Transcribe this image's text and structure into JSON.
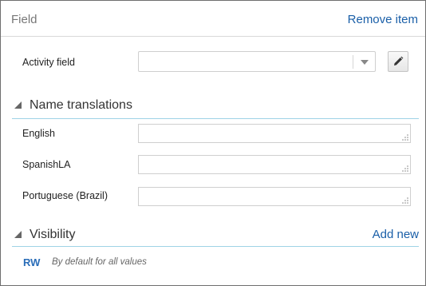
{
  "header": {
    "title": "Field",
    "remove_label": "Remove item"
  },
  "activity": {
    "label": "Activity field",
    "value": "",
    "dropdown_icon": "chevron-down-icon",
    "edit_icon": "pencil-icon"
  },
  "name_translations": {
    "title": "Name translations",
    "collapse_icon": "triangle-expanded-icon",
    "rows": [
      {
        "label": "English",
        "value": ""
      },
      {
        "label": "SpanishLA",
        "value": ""
      },
      {
        "label": "Portuguese (Brazil)",
        "value": ""
      }
    ]
  },
  "visibility": {
    "title": "Visibility",
    "add_label": "Add new",
    "collapse_icon": "triangle-expanded-icon",
    "entries": [
      {
        "code": "RW",
        "description": "By default for all values"
      }
    ]
  },
  "colors": {
    "link": "#1a5fa8",
    "section_rule": "#9fd3e6",
    "badge": "#2a6db8"
  }
}
